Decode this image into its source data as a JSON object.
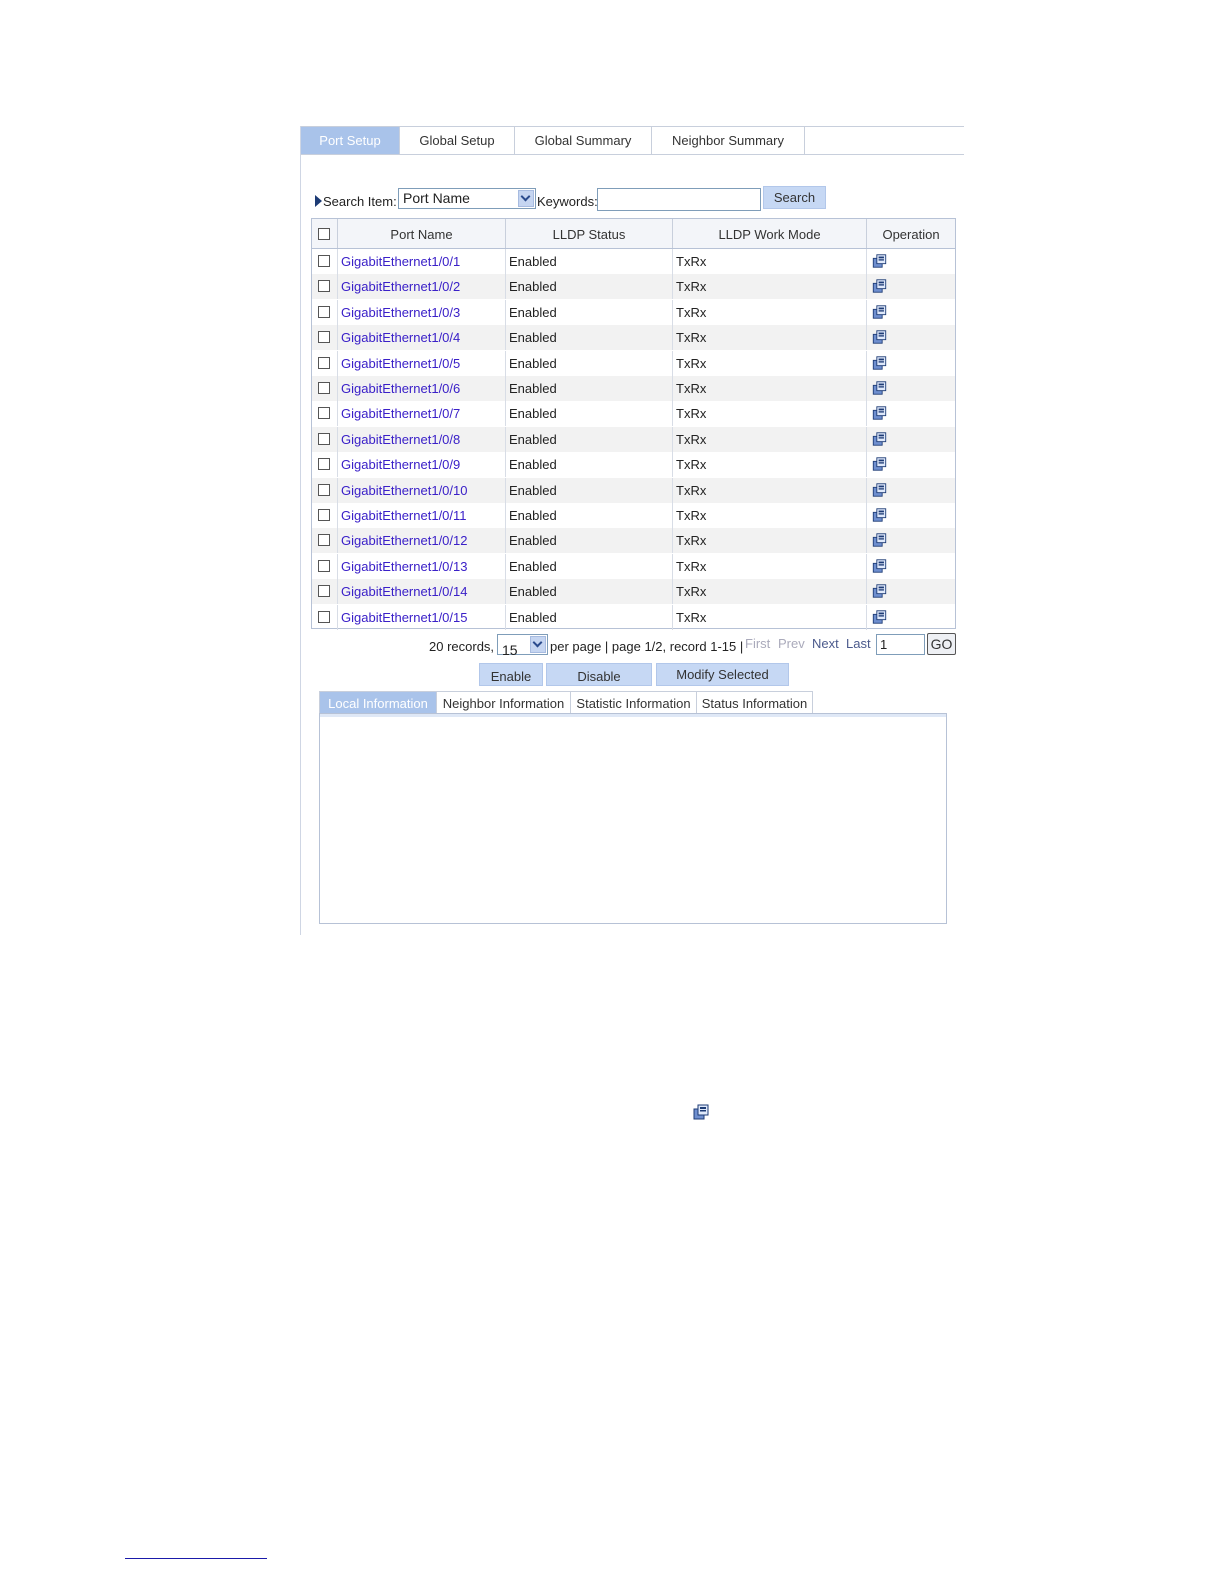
{
  "colors": {
    "accent": "#a9c3ea",
    "link": "#3a20c8",
    "button": "#c6d8f4"
  },
  "tabs": [
    {
      "label": "Port Setup",
      "active": true
    },
    {
      "label": "Global Setup",
      "active": false
    },
    {
      "label": "Global Summary",
      "active": false
    },
    {
      "label": "Neighbor Summary",
      "active": false
    }
  ],
  "search": {
    "item_label": "Search Item:",
    "item_value": "Port Name",
    "keywords_label": "Keywords:",
    "keywords_value": "",
    "button": "Search"
  },
  "table": {
    "columns": [
      "Port Name",
      "LLDP Status",
      "LLDP Work Mode",
      "Operation"
    ],
    "rows": [
      {
        "port": "GigabitEthernet1/0/1",
        "status": "Enabled",
        "mode": "TxRx"
      },
      {
        "port": "GigabitEthernet1/0/2",
        "status": "Enabled",
        "mode": "TxRx"
      },
      {
        "port": "GigabitEthernet1/0/3",
        "status": "Enabled",
        "mode": "TxRx"
      },
      {
        "port": "GigabitEthernet1/0/4",
        "status": "Enabled",
        "mode": "TxRx"
      },
      {
        "port": "GigabitEthernet1/0/5",
        "status": "Enabled",
        "mode": "TxRx"
      },
      {
        "port": "GigabitEthernet1/0/6",
        "status": "Enabled",
        "mode": "TxRx"
      },
      {
        "port": "GigabitEthernet1/0/7",
        "status": "Enabled",
        "mode": "TxRx"
      },
      {
        "port": "GigabitEthernet1/0/8",
        "status": "Enabled",
        "mode": "TxRx"
      },
      {
        "port": "GigabitEthernet1/0/9",
        "status": "Enabled",
        "mode": "TxRx"
      },
      {
        "port": "GigabitEthernet1/0/10",
        "status": "Enabled",
        "mode": "TxRx"
      },
      {
        "port": "GigabitEthernet1/0/11",
        "status": "Enabled",
        "mode": "TxRx"
      },
      {
        "port": "GigabitEthernet1/0/12",
        "status": "Enabled",
        "mode": "TxRx"
      },
      {
        "port": "GigabitEthernet1/0/13",
        "status": "Enabled",
        "mode": "TxRx"
      },
      {
        "port": "GigabitEthernet1/0/14",
        "status": "Enabled",
        "mode": "TxRx"
      },
      {
        "port": "GigabitEthernet1/0/15",
        "status": "Enabled",
        "mode": "TxRx"
      }
    ],
    "operation_icon": "modify-icon"
  },
  "pager": {
    "records": "20 records,",
    "per_page_value": "15",
    "per_page_text": "per page | page 1/2, record 1-15 |",
    "first": "First",
    "prev": "Prev",
    "next": "Next",
    "last": "Last",
    "page_value": "1",
    "go": "GO"
  },
  "actions": {
    "enable": "Enable",
    "disable": "Disable",
    "modify": "Modify Selected"
  },
  "info_tabs": [
    {
      "label": "Local Information",
      "active": true
    },
    {
      "label": "Neighbor Information",
      "active": false
    },
    {
      "label": "Statistic Information",
      "active": false
    },
    {
      "label": "Status Information",
      "active": false
    }
  ]
}
